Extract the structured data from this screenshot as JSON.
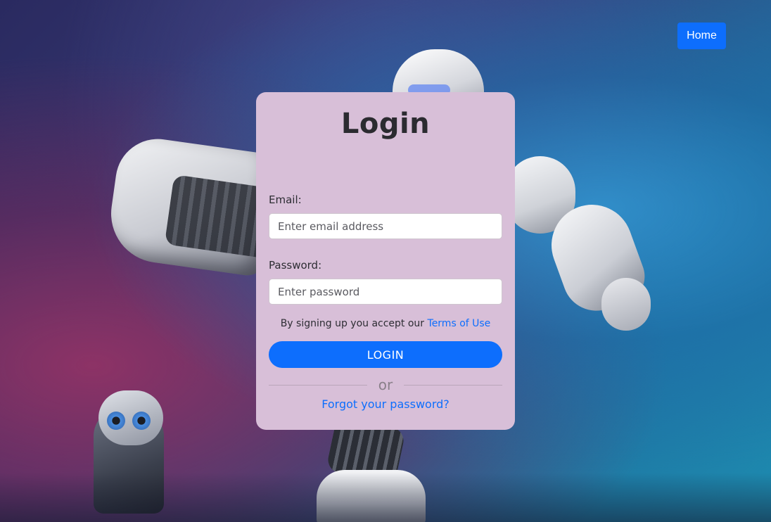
{
  "nav": {
    "home_label": "Home"
  },
  "login_card": {
    "title": "Login",
    "email_label": "Email:",
    "email_placeholder": "Enter email address",
    "email_value": "",
    "password_label": "Password:",
    "password_placeholder": "Enter password",
    "password_value": "",
    "terms_text": "By signing up you accept our",
    "terms_link": "Terms of Use",
    "login_button": "LOGIN",
    "divider_text": "or",
    "forgot_password_link": "Forgot your password?"
  },
  "colors": {
    "primary": "#0d6efd",
    "card_background": "#d8bfd8",
    "title_text": "#2b2b30"
  },
  "background": {
    "image_subject": "robots"
  }
}
